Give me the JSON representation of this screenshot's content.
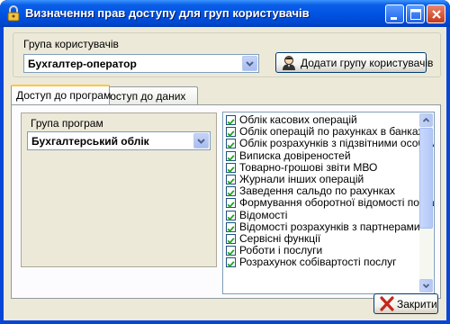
{
  "window": {
    "title": "Визначення прав доступу для груп користувачів",
    "title_bar_color": "#0054e3"
  },
  "user_group": {
    "label": "Група користувачів",
    "selected": "Бухгалтер-оператор"
  },
  "add_group_button": {
    "label": "Додати групу користувачів"
  },
  "tabs": [
    {
      "label": "Доступ до програм",
      "active": true
    },
    {
      "label": "Доступ до даних",
      "active": false
    }
  ],
  "program_group": {
    "label": "Група програм",
    "selected": "Бухгалтерський облік"
  },
  "programs": [
    {
      "label": "Облік касових операцій",
      "checked": true
    },
    {
      "label": "Облік операцій по рахунках в банках",
      "checked": true
    },
    {
      "label": "Облік розрахунків з підзвітними особами",
      "checked": true
    },
    {
      "label": "Виписка довіреностей",
      "checked": true
    },
    {
      "label": "Товарно-грошові звіти МВО",
      "checked": true
    },
    {
      "label": "Журнали інших операцій",
      "checked": true
    },
    {
      "label": "Заведення сальдо по рахунках",
      "checked": true
    },
    {
      "label": "Формування оборотної відомості по рахунках",
      "checked": true
    },
    {
      "label": "Відомості",
      "checked": true
    },
    {
      "label": "Відомості розрахунків з партнерами",
      "checked": true
    },
    {
      "label": "Сервісні функції",
      "checked": true
    },
    {
      "label": "Роботи і послуги",
      "checked": true
    },
    {
      "label": "Розрахунок собівартості послуг",
      "checked": true
    }
  ],
  "close_button": {
    "label": "Закрити"
  },
  "colors": {
    "check_mark": "#21a121",
    "close_x": "#c4281c"
  }
}
